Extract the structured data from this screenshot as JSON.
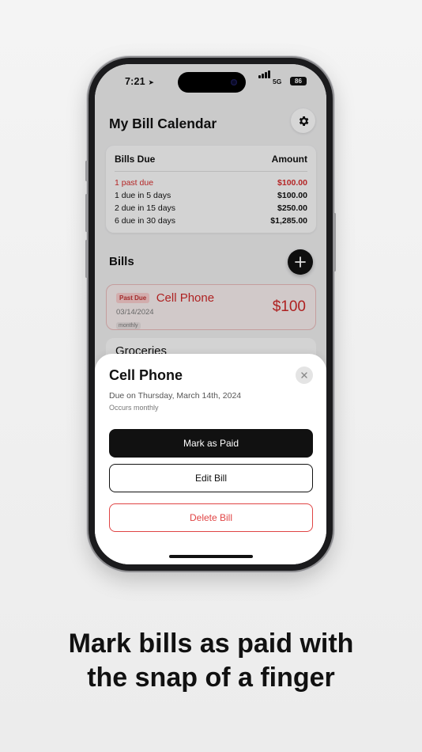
{
  "status_bar": {
    "time": "7:21",
    "network": "5G",
    "battery": "86"
  },
  "header": {
    "title": "My Bill Calendar",
    "settings_icon": "gear-icon"
  },
  "bills_due": {
    "col_label": "Bills Due",
    "col_amount": "Amount",
    "rows": [
      {
        "label": "1 past due",
        "amount": "$100.00",
        "status_color": "#cf2b2b"
      },
      {
        "label": "1 due in 5 days",
        "amount": "$100.00"
      },
      {
        "label": "2 due in 15 days",
        "amount": "$250.00"
      },
      {
        "label": "6 due in 30 days",
        "amount": "$1,285.00"
      }
    ]
  },
  "bills_section": {
    "title": "Bills",
    "add_icon": "plus-icon"
  },
  "bill_list": [
    {
      "badge": "Past Due",
      "name": "Cell Phone",
      "date": "03/14/2024",
      "frequency": "monthly",
      "amount": "$100"
    },
    {
      "name": "Groceries"
    }
  ],
  "sheet": {
    "title": "Cell Phone",
    "due_on": "Due on Thursday, March 14th, 2024",
    "occurs": "Occurs monthly",
    "mark_paid_label": "Mark as Paid",
    "edit_label": "Edit Bill",
    "delete_label": "Delete Bill",
    "close_icon": "close-icon"
  },
  "caption": {
    "line1": "Mark bills as paid with",
    "line2": "the snap of a finger"
  },
  "colors": {
    "accent": "#111111",
    "danger": "#c82727",
    "background": "#eeeeee"
  }
}
